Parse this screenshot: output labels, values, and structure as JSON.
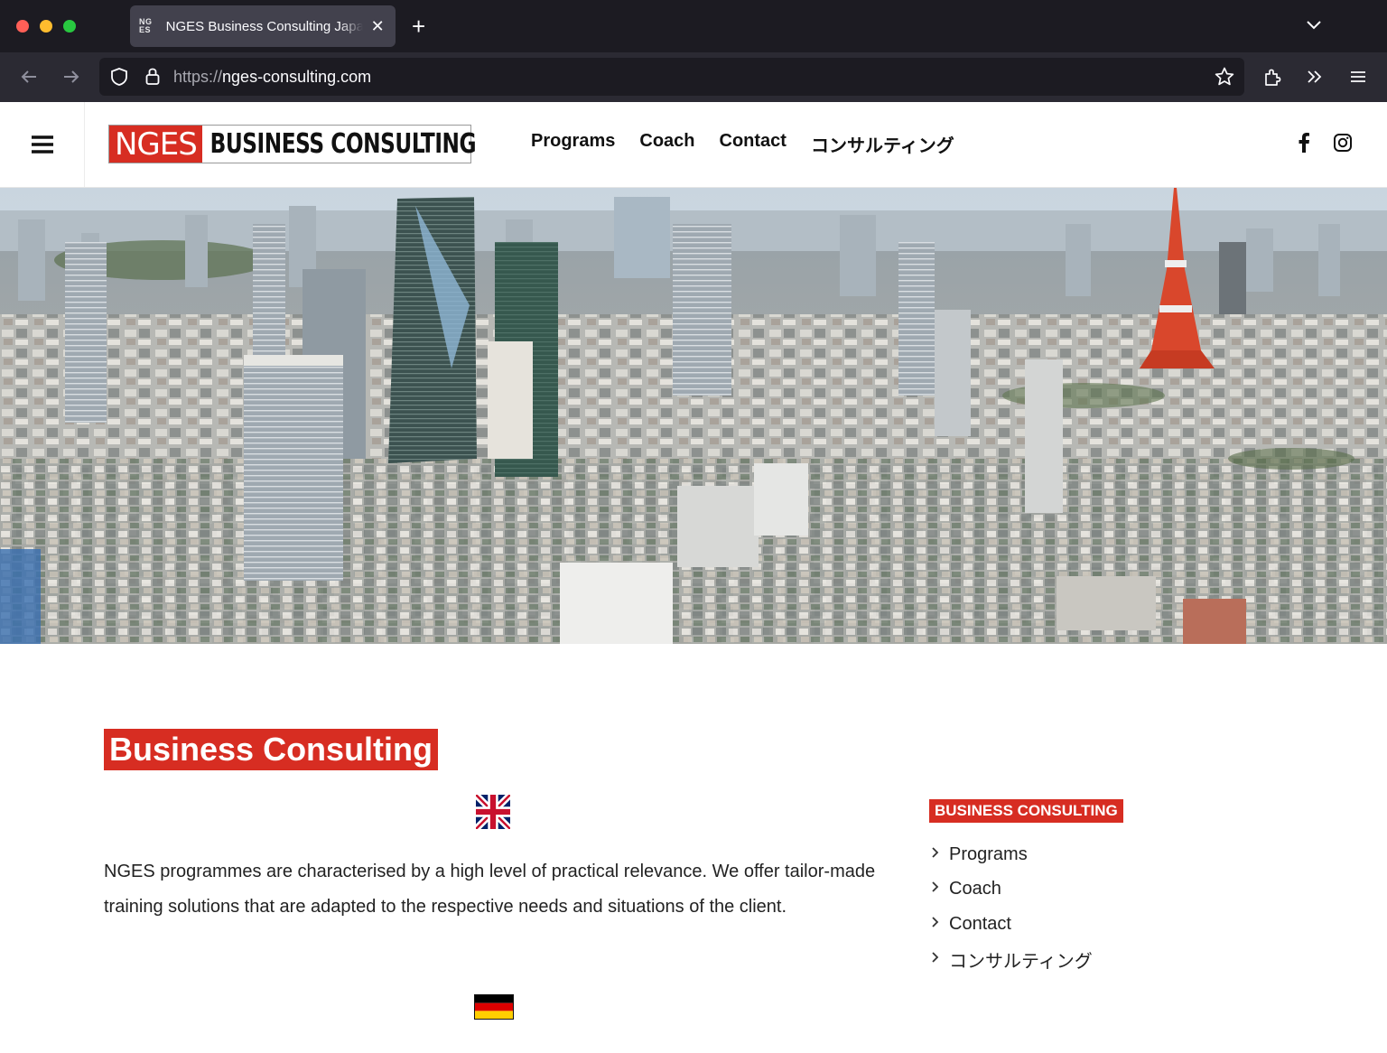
{
  "browser": {
    "tab_title": "NGES Business Consulting Japan",
    "tab_favicon_text": "NGES",
    "url_scheme": "https://",
    "url_host": "nges-consulting.com"
  },
  "site": {
    "logo_red": "NGES",
    "logo_black": "BUSINESS CONSULTING",
    "nav": [
      "Programs",
      "Coach",
      "Contact",
      "コンサルティング"
    ],
    "social": [
      "facebook-icon",
      "instagram-icon"
    ]
  },
  "content": {
    "title": "Business Consulting",
    "intro": "NGES programmes are characterised by a high level of practical relevance. We offer tailor-made training solutions that are adapted to the respective needs and situations of the client."
  },
  "sidebar": {
    "title": "BUSINESS CONSULTING",
    "items": [
      "Programs",
      "Coach",
      "Contact",
      "コンサルティング"
    ]
  },
  "colors": {
    "brand_red": "#d72d22",
    "chrome_dark": "#1c1b22",
    "chrome_toolbar": "#2b2a33"
  }
}
